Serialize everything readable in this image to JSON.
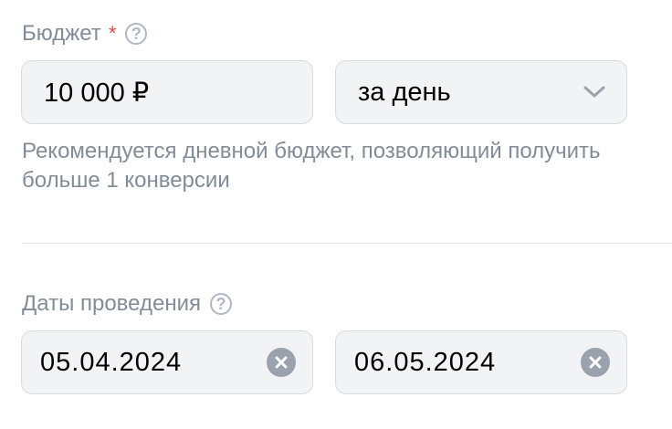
{
  "budget": {
    "label": "Бюджет",
    "required_mark": "*",
    "help_icon": "question-circle-icon",
    "amount": "10 000 ₽",
    "period": {
      "selected": "за день",
      "icon": "chevron-down-icon"
    },
    "hint": "Рекомендуется дневной бюджет, позволяющий получить больше 1 конверсии"
  },
  "dates": {
    "label": "Даты проведения",
    "help_icon": "question-circle-icon",
    "start": "05.04.2024",
    "end": "06.05.2024",
    "clear_icon": "clear-circle-icon"
  },
  "colors": {
    "label": "#818c99",
    "required": "#e64646",
    "field_bg": "#f2f3f5",
    "field_border": "#d8dbe0",
    "icon": "#99a2ad",
    "divider": "#e1e3e6"
  }
}
